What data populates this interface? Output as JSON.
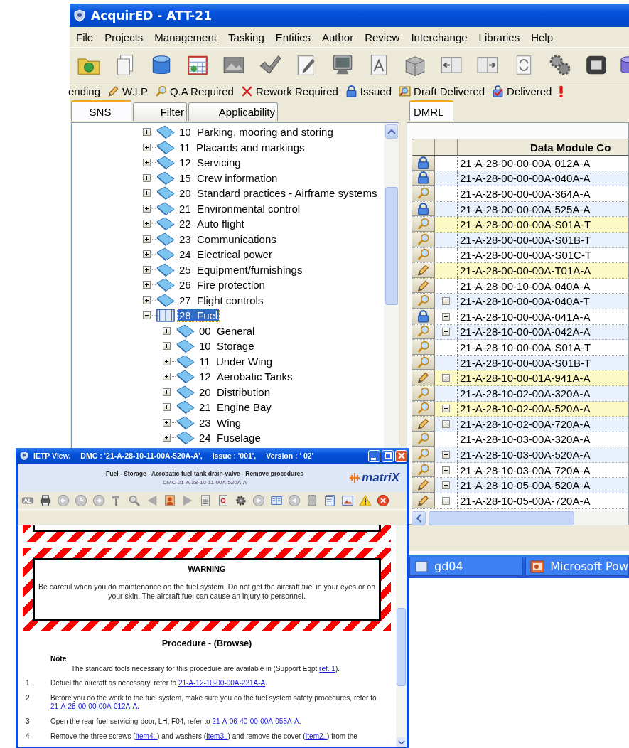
{
  "window": {
    "title": "AcquirED - ATT-21"
  },
  "menu": [
    "File",
    "Projects",
    "Management",
    "Tasking",
    "Entities",
    "Author",
    "Review",
    "Interchange",
    "Libraries",
    "Help"
  ],
  "legend": [
    {
      "kind": "pending",
      "label": "ending"
    },
    {
      "kind": "wip",
      "label": "W.I.P"
    },
    {
      "kind": "qa",
      "label": "Q.A Required"
    },
    {
      "kind": "rework",
      "label": "Rework Required"
    },
    {
      "kind": "issued",
      "label": "Issued"
    },
    {
      "kind": "draft",
      "label": "Draft Delivered"
    },
    {
      "kind": "delivered",
      "label": "Delivered"
    },
    {
      "kind": "alert"
    }
  ],
  "left_tabs": [
    {
      "label": "SNS",
      "selected": true
    },
    {
      "label": "Filter",
      "selected": false
    },
    {
      "label": "Applicability",
      "selected": false
    }
  ],
  "tree": [
    {
      "code": "10",
      "title": "Parking, mooring and storing",
      "expanded": false,
      "selected": false
    },
    {
      "code": "11",
      "title": "Placards and markings",
      "expanded": false,
      "selected": false
    },
    {
      "code": "12",
      "title": "Servicing",
      "expanded": false,
      "selected": false
    },
    {
      "code": "15",
      "title": "Crew information",
      "expanded": false,
      "selected": false
    },
    {
      "code": "20",
      "title": "Standard practices - Airframe systems",
      "expanded": false,
      "selected": false
    },
    {
      "code": "21",
      "title": "Environmental control",
      "expanded": false,
      "selected": false
    },
    {
      "code": "22",
      "title": "Auto flight",
      "expanded": false,
      "selected": false
    },
    {
      "code": "23",
      "title": "Communications",
      "expanded": false,
      "selected": false
    },
    {
      "code": "24",
      "title": "Electrical power",
      "expanded": false,
      "selected": false
    },
    {
      "code": "25",
      "title": "Equipment/furnishings",
      "expanded": false,
      "selected": false
    },
    {
      "code": "26",
      "title": "Fire protection",
      "expanded": false,
      "selected": false
    },
    {
      "code": "27",
      "title": "Flight controls",
      "expanded": false,
      "selected": false
    },
    {
      "code": "28",
      "title": "Fuel",
      "expanded": true,
      "selected": true,
      "children": [
        {
          "code": "00",
          "title": "General",
          "expanded": false,
          "selected": false
        },
        {
          "code": "10",
          "title": "Storage",
          "expanded": false,
          "selected": false
        },
        {
          "code": "11",
          "title": "Under Wing",
          "expanded": false,
          "selected": false
        },
        {
          "code": "12",
          "title": "Aerobatic Tanks",
          "expanded": false,
          "selected": false
        },
        {
          "code": "20",
          "title": "Distribution",
          "expanded": false,
          "selected": false
        },
        {
          "code": "21",
          "title": "Engine Bay",
          "expanded": false,
          "selected": false
        },
        {
          "code": "23",
          "title": "Wing",
          "expanded": false,
          "selected": false
        },
        {
          "code": "24",
          "title": "Fuselage",
          "expanded": false,
          "selected": false
        }
      ]
    }
  ],
  "right_tabs": [
    {
      "label": "DMRL",
      "selected": true
    }
  ],
  "dmrl": {
    "columns": [
      "Data Module Co"
    ],
    "rows": [
      {
        "kind": "issued",
        "expandable": false,
        "highlighted": false,
        "code": "21-A-28-00-00-00A-012A-A"
      },
      {
        "kind": "issued",
        "expandable": false,
        "highlighted": false,
        "code": "21-A-28-00-00-00A-040A-A"
      },
      {
        "kind": "qa",
        "expandable": false,
        "highlighted": false,
        "code": "21-A-28-00-00-00A-364A-A"
      },
      {
        "kind": "issued",
        "expandable": false,
        "highlighted": false,
        "code": "21-A-28-00-00-00A-525A-A"
      },
      {
        "kind": "qa",
        "expandable": false,
        "highlighted": true,
        "code": "21-A-28-00-00-00A-S01A-T"
      },
      {
        "kind": "qa",
        "expandable": false,
        "highlighted": false,
        "code": "21-A-28-00-00-00A-S01B-T"
      },
      {
        "kind": "qa",
        "expandable": false,
        "highlighted": false,
        "code": "21-A-28-00-00-00A-S01C-T"
      },
      {
        "kind": "wip",
        "expandable": false,
        "highlighted": true,
        "code": "21-A-28-00-00-00A-T01A-A"
      },
      {
        "kind": "wip",
        "expandable": false,
        "highlighted": false,
        "code": "21-A-28-00-10-00A-040A-A"
      },
      {
        "kind": "qa",
        "expandable": true,
        "highlighted": false,
        "code": "21-A-28-10-00-00A-040A-T"
      },
      {
        "kind": "issued",
        "expandable": true,
        "highlighted": false,
        "code": "21-A-28-10-00-00A-041A-A"
      },
      {
        "kind": "qa",
        "expandable": true,
        "highlighted": false,
        "code": "21-A-28-10-00-00A-042A-A"
      },
      {
        "kind": "qa",
        "expandable": false,
        "highlighted": false,
        "code": "21-A-28-10-00-00A-S01A-T"
      },
      {
        "kind": "qa",
        "expandable": false,
        "highlighted": false,
        "code": "21-A-28-10-00-00A-S01B-T"
      },
      {
        "kind": "wip",
        "expandable": true,
        "highlighted": true,
        "code": "21-A-28-10-00-01A-941A-A"
      },
      {
        "kind": "qa",
        "expandable": false,
        "highlighted": false,
        "code": "21-A-28-10-02-00A-320A-A"
      },
      {
        "kind": "qa",
        "expandable": true,
        "highlighted": true,
        "code": "21-A-28-10-02-00A-520A-A"
      },
      {
        "kind": "wip",
        "expandable": true,
        "highlighted": false,
        "code": "21-A-28-10-02-00A-720A-A"
      },
      {
        "kind": "qa",
        "expandable": false,
        "highlighted": false,
        "code": "21-A-28-10-03-00A-320A-A"
      },
      {
        "kind": "qa",
        "expandable": true,
        "highlighted": false,
        "code": "21-A-28-10-03-00A-520A-A"
      },
      {
        "kind": "qa",
        "expandable": true,
        "highlighted": false,
        "code": "21-A-28-10-03-00A-720A-A"
      },
      {
        "kind": "wip",
        "expandable": true,
        "highlighted": false,
        "code": "21-A-28-10-05-00A-520A-A"
      },
      {
        "kind": "wip",
        "expandable": true,
        "highlighted": false,
        "code": "21-A-28-10-05-00A-720A-A"
      }
    ]
  },
  "ietp": {
    "title": "IETP View.",
    "dmc": "DMC : '21-A-28-10-11-00A-520A-A',",
    "issue": "Issue : '001',",
    "version": "Version : ' 02'",
    "heading": "Fuel - Storage - Acrobatic-fuel-tank drain-valve - Remove procedures",
    "dmc_code": "DMC-21-A-28-10-11-00A-520A-A",
    "logo": "matriX",
    "warning": {
      "title": "WARNING",
      "text": "Be careful when you do maintenance on the fuel system. Do not get the aircraft fuel in your eyes or on your skin. The aircraft fuel can cause an injury to personnel."
    },
    "procedure_title": "Procedure - (Browse)",
    "note": {
      "title": "Note",
      "parts": [
        {
          "kind": "text",
          "text": "The standard tools necessary for this procedure are available in (Support Eqpt "
        },
        {
          "kind": "link",
          "text": "ref. 1"
        },
        {
          "kind": "text",
          "text": ")."
        }
      ]
    },
    "steps": [
      {
        "number": "1",
        "parts": [
          {
            "kind": "text",
            "text": "Defuel the aircraft as necessary, refer to "
          },
          {
            "kind": "link",
            "text": "21-A-12-10-00-00A-221A-A"
          },
          {
            "kind": "text",
            "text": "."
          }
        ]
      },
      {
        "number": "2",
        "parts": [
          {
            "kind": "text",
            "text": "Before you do the work to the fuel system, make sure you do the fuel system safety procedures, refer to "
          },
          {
            "kind": "link",
            "text": "21-A-28-00-00-00A-012A-A"
          },
          {
            "kind": "text",
            "text": "."
          }
        ]
      },
      {
        "number": "3",
        "parts": [
          {
            "kind": "text",
            "text": "Open the rear fuel-servicing-door, LH, F04, refer to "
          },
          {
            "kind": "link",
            "text": "21-A-06-40-00-00A-055A-A"
          },
          {
            "kind": "text",
            "text": "."
          }
        ]
      },
      {
        "number": "4",
        "parts": [
          {
            "kind": "text",
            "text": "Remove the three screws ("
          },
          {
            "kind": "link",
            "text": "Item4.."
          },
          {
            "kind": "text",
            "text": ") and washers ("
          },
          {
            "kind": "link",
            "text": "Item3.."
          },
          {
            "kind": "text",
            "text": ") and remove the cover ("
          },
          {
            "kind": "link",
            "text": "Item2.."
          },
          {
            "kind": "text",
            "text": ") from the"
          }
        ]
      }
    ]
  },
  "taskbar": [
    {
      "kind": "generic",
      "label": "gd04"
    },
    {
      "kind": "presentation",
      "label": "Microsoft Pow"
    }
  ]
}
